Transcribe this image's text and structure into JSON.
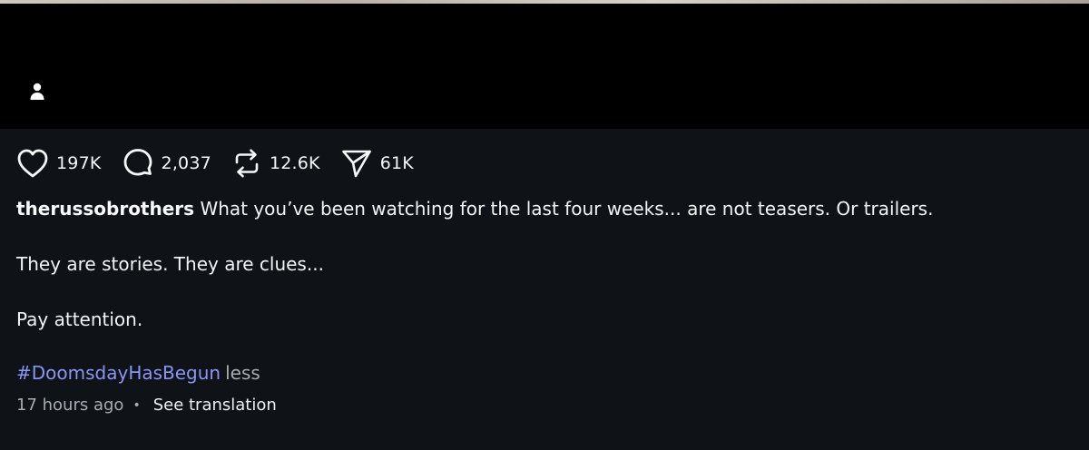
{
  "icons": {
    "user_tag": "person-icon",
    "like": "heart-icon",
    "comment": "comment-bubble-icon",
    "repost": "repost-arrows-icon",
    "share": "paper-plane-icon"
  },
  "colors": {
    "background": "#0f1216",
    "media_background": "#000000",
    "text": "#f2f4f6",
    "hashtag": "#8a95f6",
    "muted": "#a6adb5"
  },
  "actions": {
    "likes": "197K",
    "comments": "2,037",
    "reposts": "12.6K",
    "shares": "61K"
  },
  "caption": {
    "username": "therussobrothers",
    "line1": "What you’ve been watching for the last four weeks... are not teasers. Or trailers.",
    "line2": "They are stories. They are clues...",
    "line3": "Pay attention.",
    "hashtag": "#DoomsdayHasBegun",
    "less_label": "less"
  },
  "meta": {
    "timestamp": "17 hours ago",
    "separator": "•",
    "see_translation": "See translation"
  }
}
